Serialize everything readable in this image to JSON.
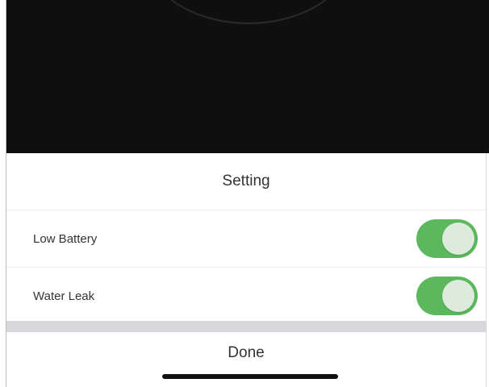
{
  "sheet": {
    "title": "Setting",
    "rows": [
      {
        "label": "Low Battery",
        "enabled": true
      },
      {
        "label": "Water Leak",
        "enabled": true
      }
    ],
    "done_label": "Done"
  },
  "colors": {
    "toggle_on": "#5cb85c",
    "backdrop": "#0f0f0f",
    "separator_band": "#d7d7dc"
  }
}
